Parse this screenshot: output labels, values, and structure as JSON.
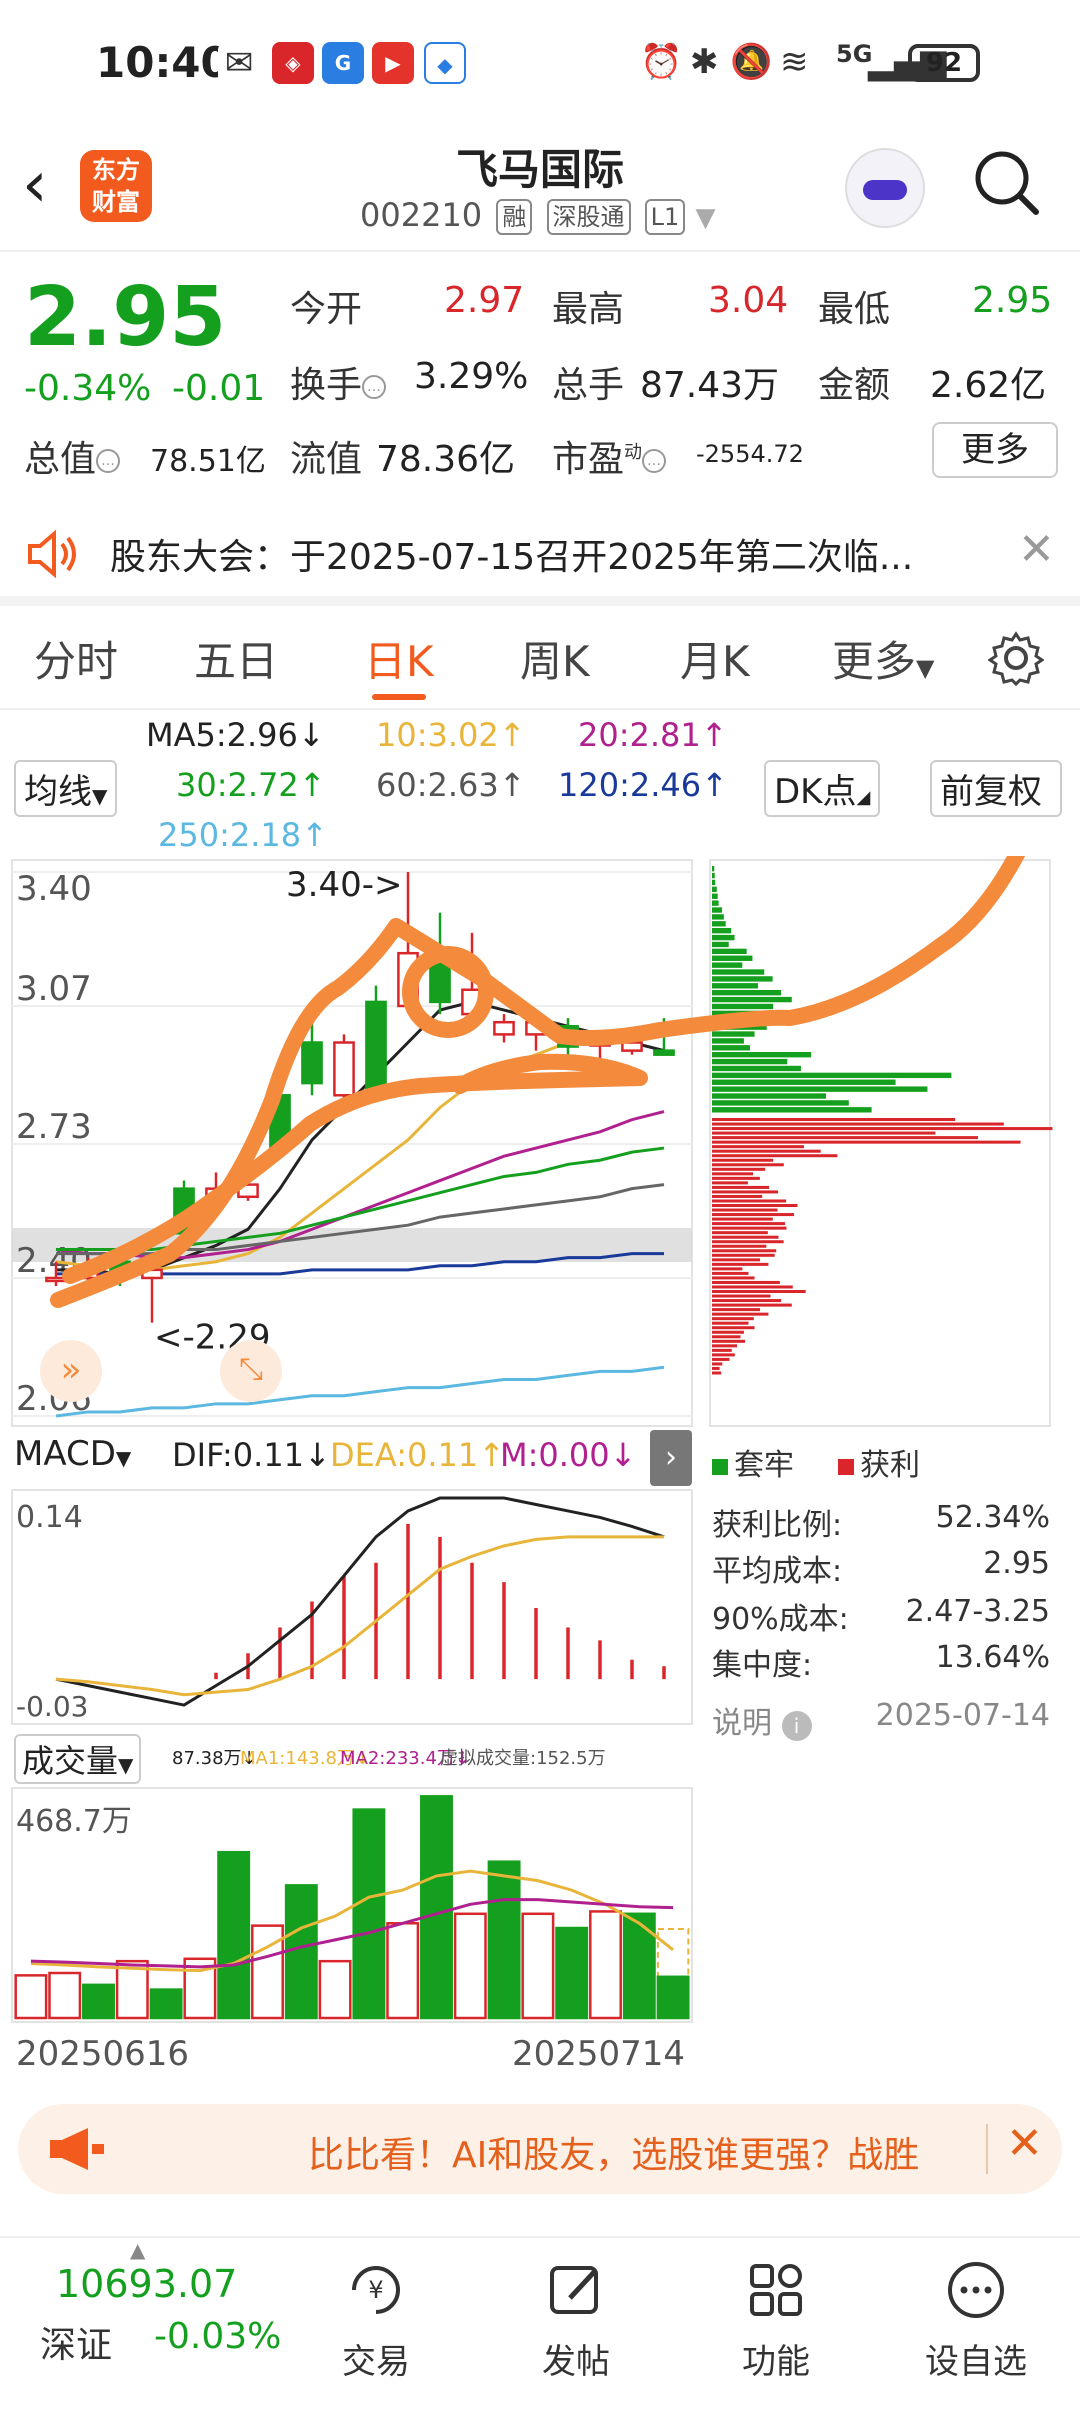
{
  "status_bar": {
    "time": "10:40",
    "network": "5G",
    "battery": "92"
  },
  "header": {
    "logo_line1": "东方",
    "logo_line2": "财富",
    "stock_name": "飞马国际",
    "stock_code": "002210",
    "tags": [
      "融",
      "深股通",
      "L1"
    ]
  },
  "quote": {
    "price": "2.95",
    "change_pct": "-0.34%",
    "change_amt": "-0.01",
    "open_label": "今开",
    "open": "2.97",
    "high_label": "最高",
    "high": "3.04",
    "low_label": "最低",
    "low": "2.95",
    "turnover_label": "换手",
    "turnover": "3.29%",
    "volume_label": "总手",
    "volume": "87.43万",
    "amount_label": "金额",
    "amount": "2.62亿",
    "mktcap_label": "总值",
    "mktcap": "78.51亿",
    "float_label": "流值",
    "float_cap": "78.36亿",
    "pe_label": "市盈",
    "pe_sup": "动",
    "pe": "-2554.72",
    "more_label": "更多"
  },
  "notice": {
    "text": "股东大会：于2025-07-15召开2025年第二次临..."
  },
  "tabs": [
    "分时",
    "五日",
    "日K",
    "周K",
    "月K",
    "更多"
  ],
  "active_tab": "日K",
  "ma_legend": {
    "ma_button": "均线",
    "ma5": "MA5:2.96↓",
    "ma10": "10:3.02↑",
    "ma20": "20:2.81↑",
    "ma30": "30:2.72↑",
    "ma60": "60:2.63↑",
    "ma120": "120:2.46↑",
    "ma250": "250:2.18↑",
    "dk_button": "DK点",
    "fq_button": "前复权",
    "colors": {
      "ma5": "#222222",
      "ma10": "#e8b53a",
      "ma20": "#b0208f",
      "ma30": "#14a01e",
      "ma60": "#666666",
      "ma120": "#1a3a9a",
      "ma250": "#5bb8e0"
    }
  },
  "kline": {
    "y_labels": [
      "3.40",
      "3.07",
      "2.73",
      "2.40",
      "2.06"
    ],
    "high_annot": "3.40->",
    "low_annot": "<-2.29"
  },
  "macd": {
    "label": "MACD",
    "dif": "DIF:0.11↓",
    "dea": "DEA:0.11↑",
    "m": "M:0.00↓",
    "top": "0.14",
    "bottom": "-0.03"
  },
  "volume": {
    "label": "成交量",
    "vol": "87.38万↓",
    "ma1": "MA1:143.8万↓",
    "ma2": "MA2:233.4万↓",
    "virtual": "虚拟成交量:152.5万",
    "top": "468.7万",
    "date_start": "20250616",
    "date_end": "20250714"
  },
  "chips": {
    "legend_locked": "套牢",
    "legend_profit": "获利",
    "rows": [
      {
        "label": "获利比例:",
        "value": "52.34%"
      },
      {
        "label": "平均成本:",
        "value": "2.95"
      },
      {
        "label": "90%成本:",
        "value": "2.47-3.25"
      },
      {
        "label": "集中度:",
        "value": "13.64%"
      }
    ],
    "note_label": "说明",
    "date": "2025-07-14"
  },
  "banner": {
    "text": "比比看！AI和股友，选股谁更强？战胜"
  },
  "bottom_nav": {
    "index_value": "10693.07",
    "index_name": "深证",
    "index_change": "-0.03%",
    "items": [
      "交易",
      "发帖",
      "功能",
      "设自选"
    ]
  },
  "chart_data": [
    {
      "type": "candlestick",
      "title": "日K",
      "x_start": "20250616",
      "x_end": "20250714",
      "ylim": [
        2.06,
        3.4
      ],
      "y_ticks": [
        3.4,
        3.07,
        2.73,
        2.4,
        2.06
      ],
      "candles": [
        {
          "o": 2.4,
          "c": 2.4,
          "h": 2.44,
          "l": 2.38,
          "up": false
        },
        {
          "o": 2.42,
          "c": 2.4,
          "h": 2.45,
          "l": 2.39,
          "up": false
        },
        {
          "o": 2.4,
          "c": 2.44,
          "h": 2.46,
          "l": 2.38,
          "up": true
        },
        {
          "o": 2.42,
          "c": 2.4,
          "h": 2.44,
          "l": 2.29,
          "up": false
        },
        {
          "o": 2.51,
          "c": 2.62,
          "h": 2.64,
          "l": 2.5,
          "up": true
        },
        {
          "o": 2.62,
          "c": 2.6,
          "h": 2.66,
          "l": 2.58,
          "up": false
        },
        {
          "o": 2.6,
          "c": 2.63,
          "h": 2.7,
          "l": 2.59,
          "up": false
        },
        {
          "o": 2.72,
          "c": 2.85,
          "h": 2.88,
          "l": 2.7,
          "up": true
        },
        {
          "o": 2.88,
          "c": 2.98,
          "h": 3.03,
          "l": 2.85,
          "up": true
        },
        {
          "o": 2.85,
          "c": 2.98,
          "h": 3.0,
          "l": 2.84,
          "up": false
        },
        {
          "o": 3.08,
          "c": 2.86,
          "h": 3.12,
          "l": 2.84,
          "up": true
        },
        {
          "o": 3.07,
          "c": 3.2,
          "h": 3.4,
          "l": 3.06,
          "up": false
        },
        {
          "o": 3.2,
          "c": 3.08,
          "h": 3.3,
          "l": 3.05,
          "up": true
        },
        {
          "o": 3.11,
          "c": 3.05,
          "h": 3.25,
          "l": 3.04,
          "up": false
        },
        {
          "o": 3.0,
          "c": 3.03,
          "h": 3.05,
          "l": 2.98,
          "up": false
        },
        {
          "o": 3.03,
          "c": 3.0,
          "h": 3.05,
          "l": 2.96,
          "up": false
        },
        {
          "o": 2.97,
          "c": 3.02,
          "h": 3.04,
          "l": 2.95,
          "up": true
        },
        {
          "o": 2.98,
          "c": 2.98,
          "h": 3.0,
          "l": 2.94,
          "up": false
        },
        {
          "o": 2.98,
          "c": 2.96,
          "h": 3.01,
          "l": 2.95,
          "up": false
        },
        {
          "o": 2.96,
          "c": 2.95,
          "h": 3.04,
          "l": 2.95,
          "up": true
        }
      ],
      "ma_lines": {
        "MA5": [
          2.42,
          2.42,
          2.41,
          2.42,
          2.45,
          2.48,
          2.52,
          2.62,
          2.74,
          2.82,
          2.9,
          2.98,
          3.06,
          3.08,
          3.06,
          3.04,
          3.02,
          3.0,
          2.98,
          2.96
        ],
        "MA10": [
          2.44,
          2.43,
          2.43,
          2.42,
          2.43,
          2.44,
          2.46,
          2.5,
          2.56,
          2.62,
          2.68,
          2.74,
          2.82,
          2.88,
          2.92,
          2.95,
          2.98,
          3.0,
          3.01,
          3.02
        ],
        "MA20": [
          2.47,
          2.46,
          2.46,
          2.45,
          2.45,
          2.46,
          2.47,
          2.49,
          2.52,
          2.55,
          2.58,
          2.61,
          2.64,
          2.67,
          2.7,
          2.72,
          2.74,
          2.76,
          2.79,
          2.81
        ],
        "MA30": [
          2.47,
          2.47,
          2.47,
          2.47,
          2.48,
          2.49,
          2.5,
          2.51,
          2.53,
          2.55,
          2.57,
          2.59,
          2.61,
          2.63,
          2.65,
          2.66,
          2.68,
          2.69,
          2.71,
          2.72
        ],
        "MA60": [
          2.46,
          2.46,
          2.46,
          2.46,
          2.47,
          2.47,
          2.48,
          2.49,
          2.5,
          2.51,
          2.52,
          2.53,
          2.55,
          2.56,
          2.57,
          2.58,
          2.59,
          2.6,
          2.62,
          2.63
        ],
        "MA120": [
          2.41,
          2.41,
          2.41,
          2.41,
          2.41,
          2.41,
          2.41,
          2.41,
          2.42,
          2.42,
          2.42,
          2.42,
          2.43,
          2.43,
          2.44,
          2.44,
          2.45,
          2.45,
          2.46,
          2.46
        ],
        "MA250": [
          2.06,
          2.07,
          2.07,
          2.08,
          2.08,
          2.09,
          2.09,
          2.1,
          2.11,
          2.11,
          2.12,
          2.13,
          2.13,
          2.14,
          2.15,
          2.15,
          2.16,
          2.17,
          2.17,
          2.18
        ]
      }
    },
    {
      "type": "bar",
      "title": "MACD",
      "ylim": [
        -0.03,
        0.14
      ],
      "dif": [
        0.0,
        -0.005,
        -0.01,
        -0.015,
        -0.02,
        -0.005,
        0.01,
        0.03,
        0.05,
        0.08,
        0.11,
        0.13,
        0.14,
        0.14,
        0.14,
        0.135,
        0.13,
        0.125,
        0.118,
        0.11
      ],
      "dea": [
        0.0,
        -0.002,
        -0.005,
        -0.008,
        -0.012,
        -0.01,
        -0.008,
        0.0,
        0.01,
        0.025,
        0.045,
        0.065,
        0.085,
        0.095,
        0.103,
        0.108,
        0.11,
        0.11,
        0.11,
        0.11
      ],
      "histogram": [
        0.0,
        0.0,
        0.0,
        0.0,
        0.0,
        0.005,
        0.02,
        0.04,
        0.06,
        0.08,
        0.09,
        0.12,
        0.11,
        0.09,
        0.075,
        0.055,
        0.04,
        0.03,
        0.015,
        0.01
      ]
    },
    {
      "type": "bar",
      "title": "成交量",
      "ylim": [
        0,
        468.7
      ],
      "unit": "万",
      "values": [
        90,
        95,
        70,
        120,
        60,
        125,
        350,
        195,
        280,
        120,
        440,
        200,
        468,
        220,
        330,
        220,
        190,
        225,
        220,
        87
      ],
      "up": [
        false,
        false,
        true,
        false,
        true,
        false,
        true,
        false,
        true,
        false,
        true,
        false,
        true,
        false,
        true,
        false,
        true,
        false,
        true,
        true
      ],
      "ma1": [
        115,
        112,
        108,
        105,
        102,
        100,
        115,
        150,
        190,
        215,
        255,
        270,
        300,
        310,
        300,
        290,
        270,
        240,
        200,
        144
      ],
      "ma2": [
        120,
        118,
        115,
        112,
        110,
        108,
        112,
        130,
        150,
        165,
        180,
        200,
        220,
        240,
        250,
        250,
        245,
        240,
        235,
        233
      ]
    },
    {
      "type": "bar",
      "title": "筹码分布",
      "series": [
        {
          "name": "套牢",
          "values": [
            3,
            6,
            12,
            22,
            38,
            55,
            70,
            60,
            40,
            90,
            210,
            150
          ]
        },
        {
          "name": "获利",
          "values": [
            320,
            280,
            110,
            70,
            45,
            60,
            75,
            80,
            70,
            65,
            55,
            40,
            85,
            70,
            55,
            40,
            30,
            20,
            10
          ]
        }
      ]
    }
  ]
}
